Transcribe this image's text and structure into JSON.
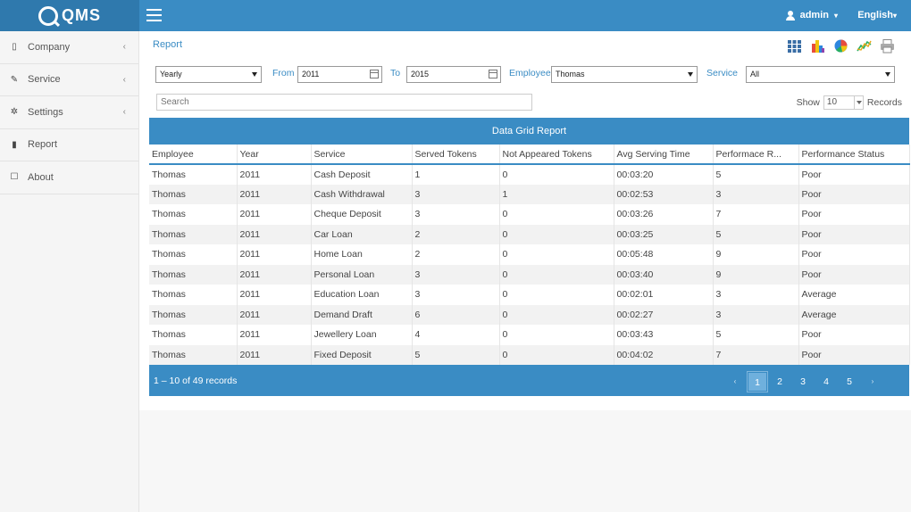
{
  "app": {
    "logo_text": "QMS",
    "user": "admin",
    "language": "English"
  },
  "sidebar": {
    "items": [
      {
        "label": "Company",
        "icon": "building-icon",
        "has_chevron": true
      },
      {
        "label": "Service",
        "icon": "wrench-icon",
        "has_chevron": true
      },
      {
        "label": "Settings",
        "icon": "gear-icon",
        "has_chevron": true
      },
      {
        "label": "Report",
        "icon": "document-icon",
        "has_chevron": false
      },
      {
        "label": "About",
        "icon": "edit-icon",
        "has_chevron": false
      }
    ]
  },
  "page": {
    "title": "Report"
  },
  "toolbar_icons": [
    "grid-view-icon",
    "bar-chart-icon",
    "pie-chart-icon",
    "line-chart-icon",
    "print-icon"
  ],
  "filters": {
    "period": "Yearly",
    "from_label": "From",
    "from_value": "2011",
    "to_label": "To",
    "to_value": "2015",
    "employee_label": "Employee",
    "employee_value": "Thomas",
    "service_label": "Service",
    "service_value": "All"
  },
  "search": {
    "placeholder": "Search"
  },
  "paging_size": {
    "show_label": "Show",
    "value": "10",
    "records_label": "Records"
  },
  "grid": {
    "title": "Data Grid Report",
    "columns": [
      "Employee",
      "Year",
      "Service",
      "Served Tokens",
      "Not Appeared Tokens",
      "Avg Serving Time",
      "Performace R...",
      "Performance Status"
    ],
    "rows": [
      [
        "Thomas",
        "2011",
        "Cash Deposit",
        "1",
        "0",
        "00:03:20",
        "5",
        "Poor"
      ],
      [
        "Thomas",
        "2011",
        "Cash Withdrawal",
        "3",
        "1",
        "00:02:53",
        "3",
        "Poor"
      ],
      [
        "Thomas",
        "2011",
        "Cheque Deposit",
        "3",
        "0",
        "00:03:26",
        "7",
        "Poor"
      ],
      [
        "Thomas",
        "2011",
        "Car Loan",
        "2",
        "0",
        "00:03:25",
        "5",
        "Poor"
      ],
      [
        "Thomas",
        "2011",
        "Home Loan",
        "2",
        "0",
        "00:05:48",
        "9",
        "Poor"
      ],
      [
        "Thomas",
        "2011",
        "Personal Loan",
        "3",
        "0",
        "00:03:40",
        "9",
        "Poor"
      ],
      [
        "Thomas",
        "2011",
        "Education Loan",
        "3",
        "0",
        "00:02:01",
        "3",
        "Average"
      ],
      [
        "Thomas",
        "2011",
        "Demand Draft",
        "6",
        "0",
        "00:02:27",
        "3",
        "Average"
      ],
      [
        "Thomas",
        "2011",
        "Jewellery Loan",
        "4",
        "0",
        "00:03:43",
        "5",
        "Poor"
      ],
      [
        "Thomas",
        "2011",
        "Fixed Deposit",
        "5",
        "0",
        "00:04:02",
        "7",
        "Poor"
      ]
    ],
    "footer_info": "1 – 10 of 49 records",
    "pages": [
      "1",
      "2",
      "3",
      "4",
      "5"
    ],
    "active_page": "1",
    "prev_glyph": "‹",
    "next_glyph": "›"
  },
  "colors": {
    "primary": "#3a8cc4",
    "logo_bg": "#2f79ad"
  }
}
